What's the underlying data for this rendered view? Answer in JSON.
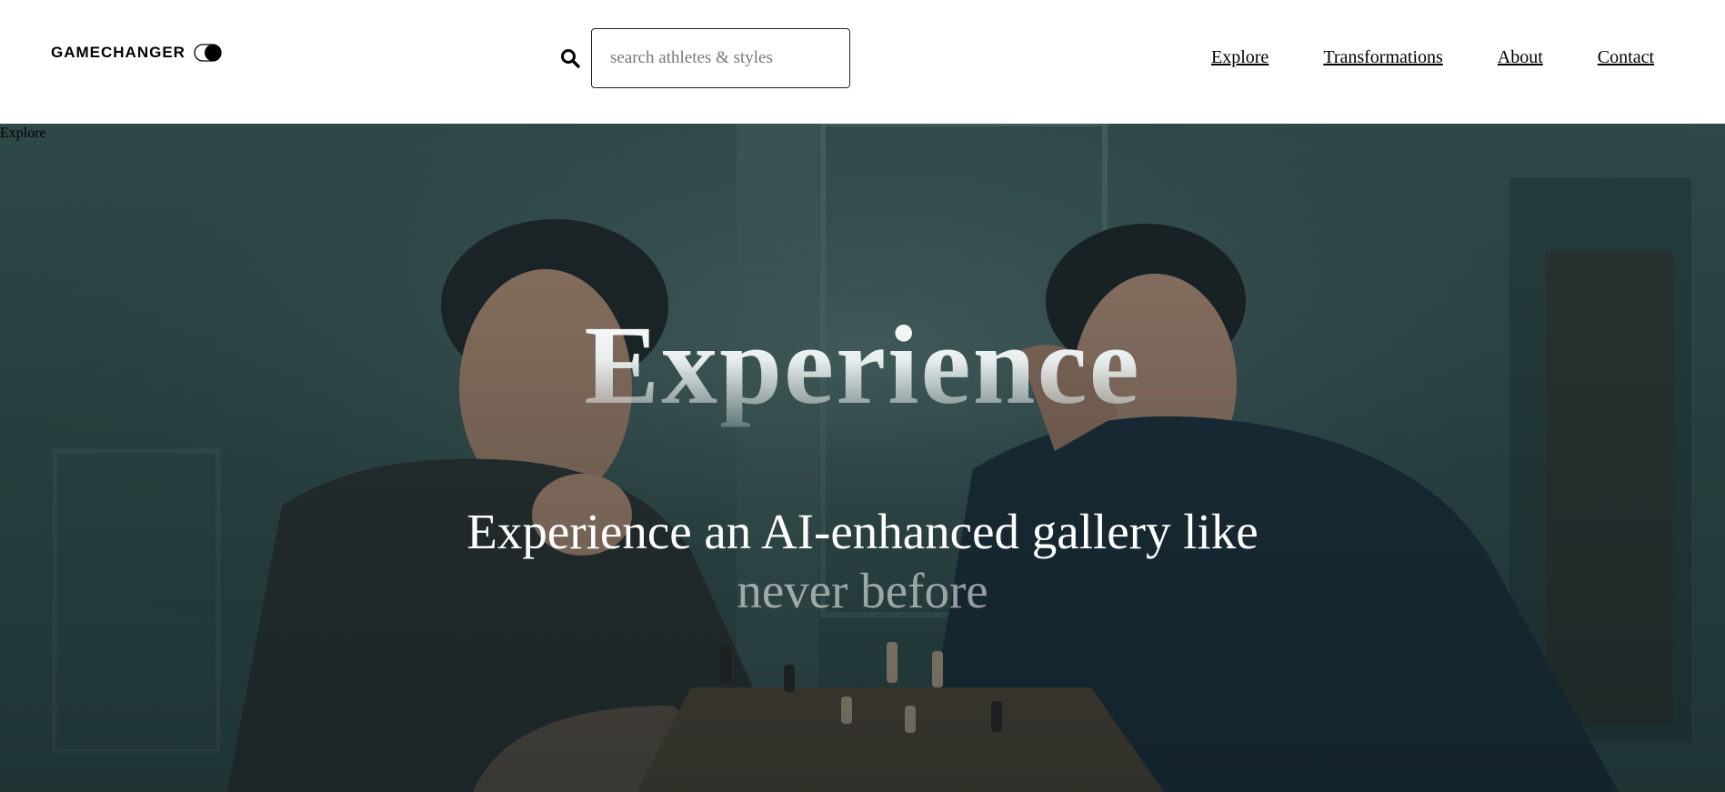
{
  "header": {
    "logo_text": "GAMECHANGER",
    "logo_icon": "theme-toggle-icon",
    "search": {
      "icon": "search-icon",
      "placeholder": "search athletes & styles",
      "value": ""
    },
    "nav": {
      "explore": "Explore",
      "transformations": "Transformations",
      "about": "About",
      "contact": "Contact"
    }
  },
  "hero": {
    "stray_label": "Explore",
    "title": "Experience",
    "subtitle_line1": "Experience an AI-enhanced gallery like",
    "subtitle_line2": "never before",
    "background_image": "two-men-playing-chess-photo"
  },
  "colors": {
    "header_bg": "#ffffff",
    "hero_bg": "#3d5d60",
    "text_dark": "#000000",
    "text_light": "#ffffff"
  }
}
